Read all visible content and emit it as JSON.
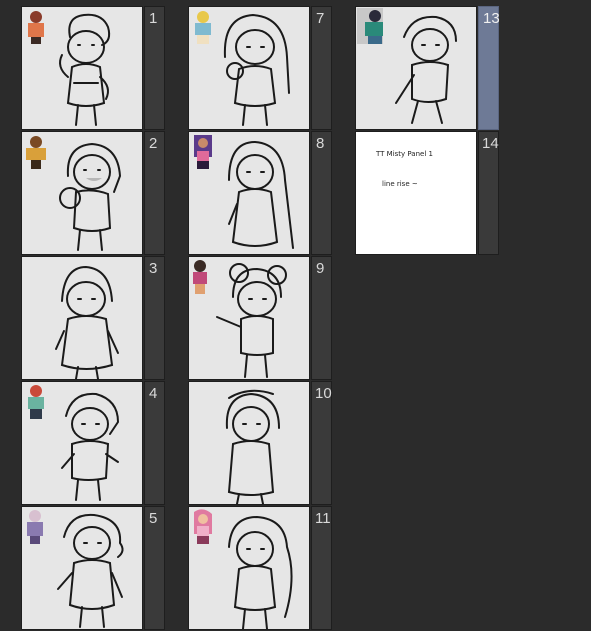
{
  "panel": {
    "pages": [
      {
        "number": "1",
        "ref_colors": [
          "#8a3b2a",
          "#e0764a",
          "#3b2a24"
        ],
        "selected": false
      },
      {
        "number": "2",
        "ref_colors": [
          "#d9a03a",
          "#7a4a24",
          "#3b2a1a"
        ],
        "selected": false
      },
      {
        "number": "3",
        "ref_colors": [],
        "selected": false
      },
      {
        "number": "4",
        "ref_colors": [
          "#c94a3a",
          "#6ab3a0",
          "#2f3a4a"
        ],
        "selected": false
      },
      {
        "number": "5",
        "ref_colors": [
          "#8a7ab0",
          "#d8c0d0",
          "#5a4a7a"
        ],
        "selected": false
      },
      {
        "number": "7",
        "ref_colors": [
          "#e8c84a",
          "#7fbad0",
          "#f0e0c0"
        ],
        "selected": false
      },
      {
        "number": "8",
        "ref_colors": [
          "#5a3a8a",
          "#e06a9a",
          "#2a1a3a"
        ],
        "selected": false
      },
      {
        "number": "9",
        "ref_colors": [
          "#c04a7a",
          "#3a2a24",
          "#e0a070"
        ],
        "selected": false
      },
      {
        "number": "10",
        "ref_colors": [],
        "selected": false
      },
      {
        "number": "11",
        "ref_colors": [
          "#e07aa0",
          "#f0b0c8",
          "#8a3a5a"
        ],
        "selected": false
      },
      {
        "number": "13",
        "ref_colors": [
          "#2a8a7a",
          "#3a6a8a",
          "#2a2a3a"
        ],
        "selected": true
      },
      {
        "number": "14",
        "ref_colors": [],
        "selected": false
      }
    ],
    "note_page": {
      "line1": "TT Misty Panel 1",
      "line2": "line rise ~"
    }
  }
}
